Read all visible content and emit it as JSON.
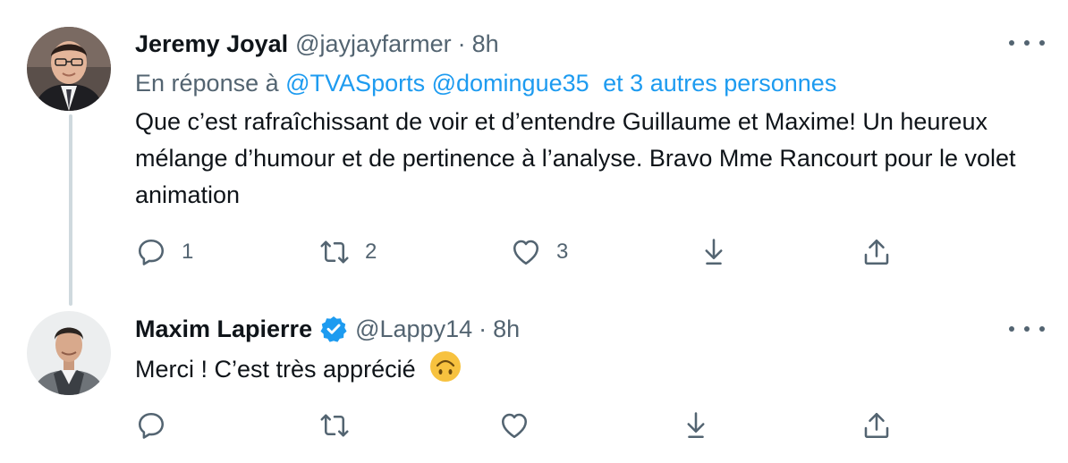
{
  "tweet1": {
    "name": "Jeremy Joyal",
    "handle": "@jayjayfarmer",
    "separator": "·",
    "time": "8h",
    "reply_prefix": "En réponse à",
    "mentions": [
      "@TVASports",
      "@domingue35",
      "et 3 autres personnes"
    ],
    "text": "Que c’est rafraîchissant de voir et d’entendre Guillaume et Maxime! Un heureux mélange d’humour et de pertinence à l’analyse. Bravo Mme Rancourt pour le volet animation",
    "reply_count": "1",
    "retweet_count": "2",
    "like_count": "3"
  },
  "tweet2": {
    "name": "Maxim Lapierre",
    "handle": "@Lappy14",
    "separator": "·",
    "time": "8h",
    "verified": true,
    "text": "Merci ! C’est très apprécié",
    "emoji": "upside-down-face"
  },
  "icons": {
    "reply": "reply-icon",
    "retweet": "retweet-icon",
    "like": "heart-icon",
    "share": "share-icon",
    "bookmark": "download-icon",
    "more": "more-icon"
  },
  "colors": {
    "accent": "#1d9bf0",
    "secondary": "#536471",
    "text": "#0f1419",
    "thread_line": "#cfd9de"
  }
}
